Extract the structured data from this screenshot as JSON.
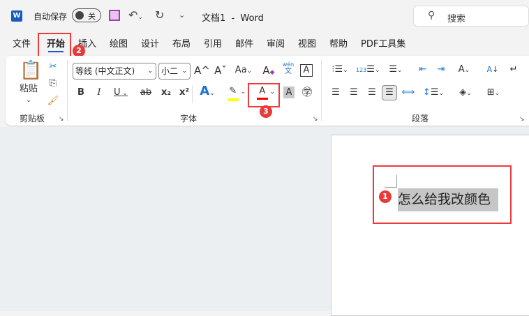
{
  "titlebar": {
    "app_icon": "word-icon",
    "autosave_label": "自动保存",
    "autosave_state": "关",
    "undo": "undo-icon",
    "redo": "redo-icon",
    "customize": "customize-icon",
    "title": "文档1  -  Word",
    "search_placeholder": "搜索"
  },
  "tabs": [
    {
      "label": "文件"
    },
    {
      "label": "开始",
      "active": true
    },
    {
      "label": "插入"
    },
    {
      "label": "绘图"
    },
    {
      "label": "设计"
    },
    {
      "label": "布局"
    },
    {
      "label": "引用"
    },
    {
      "label": "邮件"
    },
    {
      "label": "审阅"
    },
    {
      "label": "视图"
    },
    {
      "label": "帮助"
    },
    {
      "label": "PDF工具集"
    }
  ],
  "ribbon": {
    "clipboard": {
      "paste_label": "粘贴",
      "group_label": "剪贴板"
    },
    "font": {
      "font_name": "等线 (中文正文)",
      "font_size": "小二",
      "group_label": "字体",
      "bold": "B",
      "italic": "I",
      "underline": "U",
      "strike": "ab",
      "sub": "x₂",
      "sup": "x²",
      "font_color": "#ff0000",
      "highlight_color": "#ffff00",
      "grow": "A^",
      "shrink": "Aˇ",
      "case": "Aa",
      "pinyin_top": "wén",
      "pinyin_bottom": "文"
    },
    "paragraph": {
      "group_label": "段落"
    }
  },
  "annotations": [
    "1",
    "2",
    "3"
  ],
  "document": {
    "text": "怎么给我改颜色"
  },
  "colors": {
    "accent": "#185abd",
    "annotation_red": "#f0393b",
    "selection": "#c6c6c6"
  }
}
